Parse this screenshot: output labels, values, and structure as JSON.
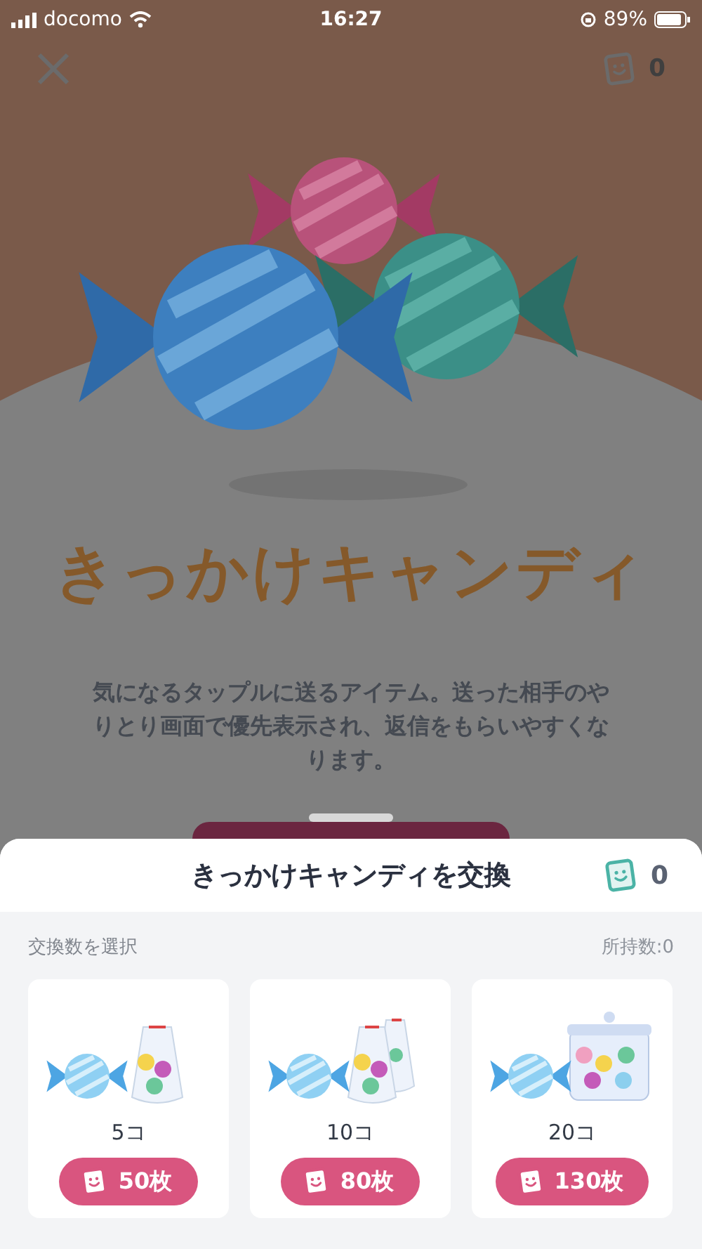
{
  "status_bar": {
    "carrier": "docomo",
    "time": "16:27",
    "battery": "89%"
  },
  "top_bar": {
    "ticket_count": "0"
  },
  "logo_title": "きっかけキャンディ",
  "description": "気になるタップルに送るアイテム。送った相手のやりとり画面で優先表示され、返信をもらいやすくなります。",
  "sheet": {
    "title": "きっかけキャンディを交換",
    "ticket_count": "0",
    "section_label": "交換数を選択",
    "owned": "所持数:0",
    "options": [
      {
        "kind": "bag",
        "quantity": "5コ",
        "price": "50枚"
      },
      {
        "kind": "two_bags",
        "quantity": "10コ",
        "price": "80枚"
      },
      {
        "kind": "jar",
        "quantity": "20コ",
        "price": "130枚"
      }
    ]
  }
}
